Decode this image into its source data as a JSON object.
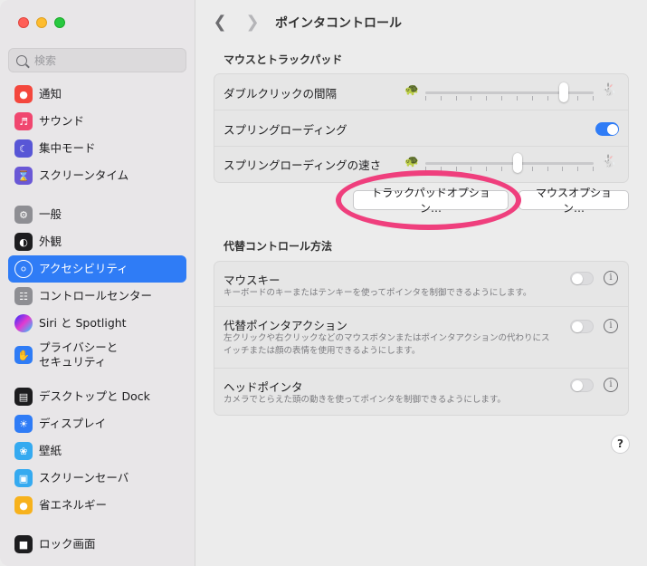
{
  "search": {
    "placeholder": "検索"
  },
  "sidebar": {
    "items": [
      {
        "label": "通知",
        "icon": "bell-icon",
        "color": "#f4473d"
      },
      {
        "label": "サウンド",
        "icon": "speaker-icon",
        "color": "#f0476f"
      },
      {
        "label": "集中モード",
        "icon": "moon-icon",
        "color": "#5856d6"
      },
      {
        "label": "スクリーンタイム",
        "icon": "hourglass-icon",
        "color": "#6a58d6"
      },
      {
        "label": "一般",
        "icon": "gear-icon",
        "color": "#8e8e93"
      },
      {
        "label": "外観",
        "icon": "appearance-icon",
        "color": "#1d1d1f"
      },
      {
        "label": "アクセシビリティ",
        "icon": "accessibility-icon",
        "color": "#2f7cf6"
      },
      {
        "label": "コントロールセンター",
        "icon": "control-center-icon",
        "color": "#8e8e93"
      },
      {
        "label": "Siri と Spotlight",
        "icon": "siri-icon",
        "color": "#7a3ff0"
      },
      {
        "label": "プライバシーと\nセキュリティ",
        "icon": "hand-icon",
        "color": "#2f7cf6"
      },
      {
        "label": "デスクトップと Dock",
        "icon": "dock-icon",
        "color": "#1d1d1f"
      },
      {
        "label": "ディスプレイ",
        "icon": "sun-icon",
        "color": "#2f7cf6"
      },
      {
        "label": "壁紙",
        "icon": "flower-icon",
        "color": "#35aaf0"
      },
      {
        "label": "スクリーンセーバ",
        "icon": "screensaver-icon",
        "color": "#35aaf0"
      },
      {
        "label": "省エネルギー",
        "icon": "bulb-icon",
        "color": "#f7b21d"
      },
      {
        "label": "ロック画面",
        "icon": "lock-icon",
        "color": "#1d1d1f"
      }
    ]
  },
  "header": {
    "title": "ポインタコントロール"
  },
  "mouse_section": {
    "title": "マウスとトラックパッド",
    "double_click_label": "ダブルクリックの間隔",
    "double_click_value": 0.84,
    "spring_loading_label": "スプリングローディング",
    "spring_loading_on": true,
    "spring_speed_label": "スプリングローディングの速さ",
    "spring_speed_value": 0.55
  },
  "buttons": {
    "trackpad_options": "トラックパッドオプション…",
    "mouse_options": "マウスオプション…"
  },
  "alt_section": {
    "title": "代替コントロール方法",
    "mouse_keys_label": "マウスキー",
    "mouse_keys_desc": "キーボードのキーまたはテンキーを使ってポインタを制御できるようにします。",
    "alt_pointer_label": "代替ポインタアクション",
    "alt_pointer_desc": "左クリックや右クリックなどのマウスボタンまたはポインタアクションの代わりにスイッチまたは顔の表情を使用できるようにします。",
    "head_pointer_label": "ヘッドポインタ",
    "head_pointer_desc": "カメラでとらえた頭の動きを使ってポインタを制御できるようにします。"
  },
  "help_label": "?"
}
